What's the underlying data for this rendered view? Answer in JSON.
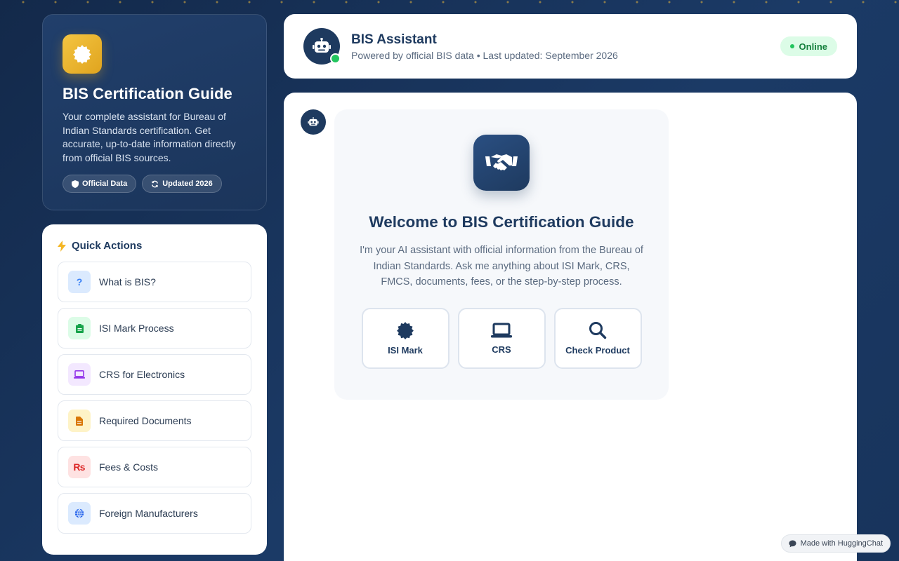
{
  "sidebar": {
    "title": "BIS Certification Guide",
    "description": "Your complete assistant for Bureau of Indian Standards certification. Get accurate, up-to-date information directly from official BIS sources.",
    "badges": [
      {
        "label": "Official Data",
        "icon": "shield-icon"
      },
      {
        "label": "Updated 2026",
        "icon": "refresh-icon"
      }
    ]
  },
  "quick_actions": {
    "title": "Quick Actions",
    "items": [
      {
        "label": "What is BIS?",
        "icon": "question-icon",
        "color": "#3b82f6",
        "bg": "#dbeafe",
        "glyph": "?"
      },
      {
        "label": "ISI Mark Process",
        "icon": "clipboard-icon",
        "color": "#16a34a",
        "bg": "#dcfce7",
        "glyph": ""
      },
      {
        "label": "CRS for Electronics",
        "icon": "laptop-icon",
        "color": "#9333ea",
        "bg": "#f3e8ff",
        "glyph": ""
      },
      {
        "label": "Required Documents",
        "icon": "document-icon",
        "color": "#d97706",
        "bg": "#fef3c7",
        "glyph": ""
      },
      {
        "label": "Fees & Costs",
        "icon": "rupee-icon",
        "color": "#dc2626",
        "bg": "#fee2e2",
        "glyph": "₨"
      },
      {
        "label": "Foreign Manufacturers",
        "icon": "globe-icon",
        "color": "#2563eb",
        "bg": "#dbeafe",
        "glyph": ""
      }
    ]
  },
  "header": {
    "title": "BIS Assistant",
    "subtitle": "Powered by official BIS data • Last updated: September 2026",
    "status": "Online"
  },
  "welcome": {
    "title": "Welcome to BIS Certification Guide",
    "description": "I'm your AI assistant with official information from the Bureau of Indian Standards. Ask me anything about ISI Mark, CRS, FMCS, documents, fees, or the step-by-step process.",
    "topics": [
      {
        "label": "ISI Mark",
        "icon": "seal-icon"
      },
      {
        "label": "CRS",
        "icon": "laptop-icon"
      },
      {
        "label": "Check Product",
        "icon": "search-icon"
      }
    ]
  },
  "footer": {
    "made_with": "Made with HuggingChat"
  },
  "colors": {
    "primary": "#1e3a5f",
    "accent": "#f4c542",
    "online": "#22c55e"
  }
}
